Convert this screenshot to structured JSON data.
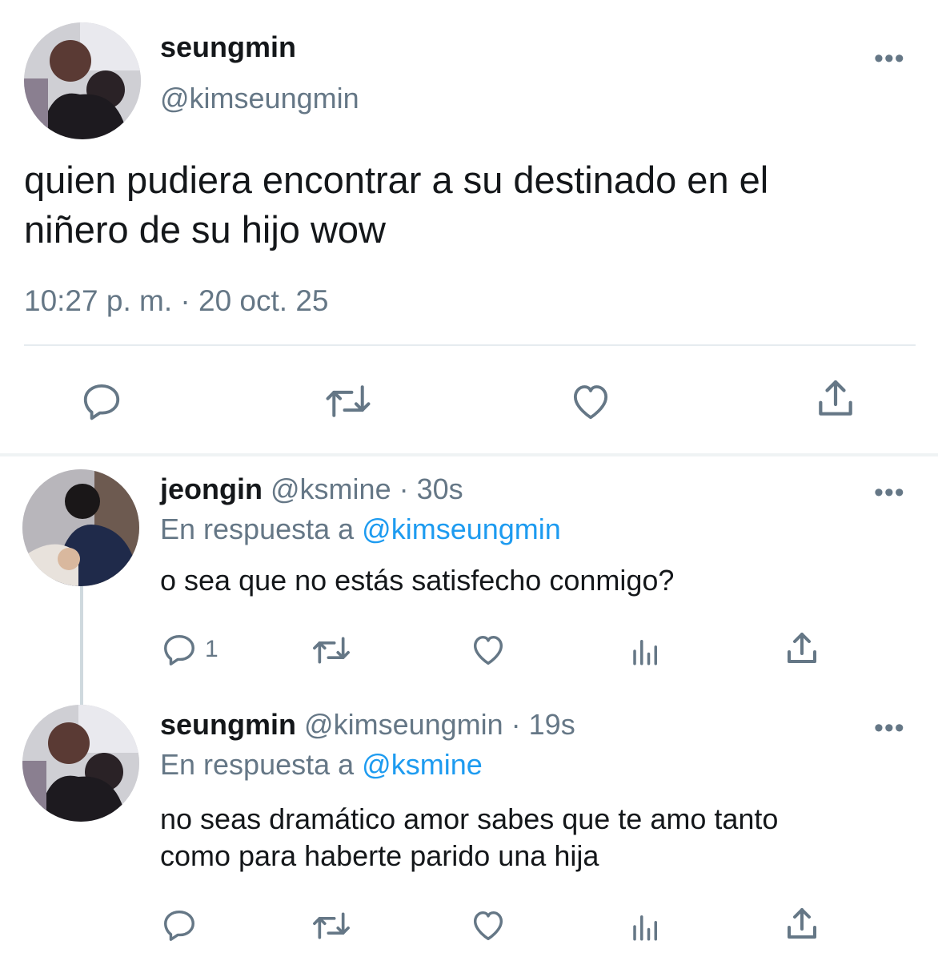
{
  "main_tweet": {
    "name": "seungmin",
    "handle": "@kimseungmin",
    "text_line1": "quien pudiera encontrar a su destinado en el",
    "text_line2": "niñero de su hijo wow",
    "timestamp": "10:27 p. m. · 20 oct. 25",
    "actions": [
      "reply-icon",
      "retweet-icon",
      "like-icon",
      "share-icon"
    ]
  },
  "replies": [
    {
      "name": "jeongin",
      "handle": "@ksmine",
      "time": "· 30s",
      "reply_prefix": "En respuesta a",
      "reply_to": "@kimseungmin",
      "text_line1": "o sea que no estás satisfecho conmigo?",
      "reply_count": "1"
    },
    {
      "name": "seungmin",
      "handle": "@kimseungmin",
      "time": "· 19s",
      "reply_prefix": "En respuesta a",
      "reply_to": "@ksmine",
      "text_line1": "no seas dramático amor sabes que te amo tanto",
      "text_line2": "como para haberte parido una hija",
      "reply_count": ""
    }
  ],
  "more_label": "•••",
  "colors": {
    "accent": "#1d9bf0",
    "secondary": "#657786",
    "text": "#14171a",
    "divider": "#e6ecf0"
  }
}
